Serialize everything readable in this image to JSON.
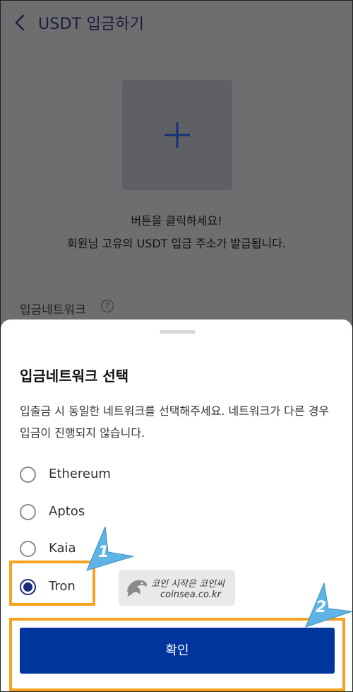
{
  "header": {
    "title": "USDT 입금하기"
  },
  "main": {
    "hint_line1": "버튼을 클릭하세요!",
    "hint_line2": "회원님 고유의 USDT 입금 주소가 발급됩니다.",
    "network_label": "입금네트워크",
    "help_glyph": "?"
  },
  "sheet": {
    "title": "입금네트워크 선택",
    "description": "입출금 시 동일한 네트워크를 선택해주세요. 네트워크가 다른 경우 입금이 진행되지 않습니다.",
    "options": [
      {
        "label": "Ethereum",
        "selected": false
      },
      {
        "label": "Aptos",
        "selected": false
      },
      {
        "label": "Kaia",
        "selected": false
      },
      {
        "label": "Tron",
        "selected": true
      }
    ],
    "confirm_label": "확인"
  },
  "annotations": {
    "step1": "1",
    "step2": "2"
  },
  "watermark": {
    "line1": "코인 시작은 코인씨",
    "line2": "coinsea.co.kr"
  },
  "colors": {
    "primary": "#00359d",
    "highlight": "#f7a21e",
    "annotation_arrow": "#5fb4e6"
  }
}
